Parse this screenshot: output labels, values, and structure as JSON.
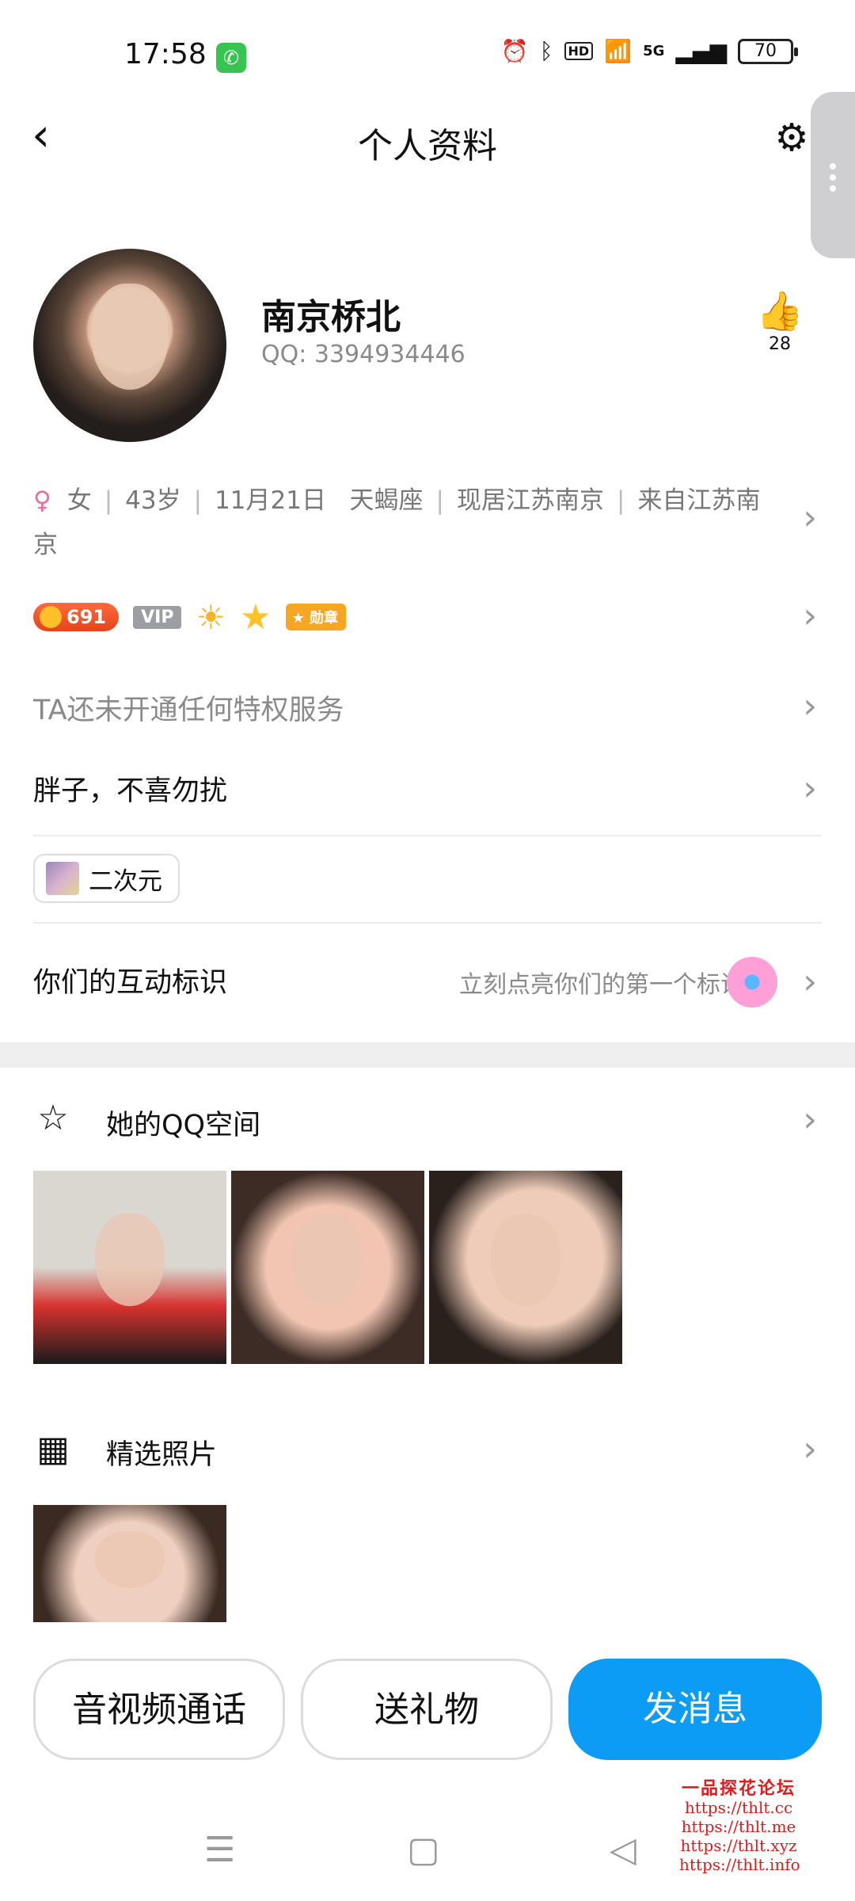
{
  "statusbar": {
    "time": "17:58",
    "network": "5G",
    "hd": "HD",
    "battery": "70"
  },
  "nav": {
    "title": "个人资料"
  },
  "profile": {
    "nickname": "南京桥北",
    "qq": "QQ: 3394934446",
    "likes": "28"
  },
  "info": {
    "gender_symbol": "♀",
    "gender": "女",
    "age": "43岁",
    "birthday": "11月21日",
    "zodiac": "天蝎座",
    "location": "现居江苏南京",
    "hometown_line1": "来自江苏南",
    "hometown_line2": "京"
  },
  "badges": {
    "level": "691",
    "vip": "VIP",
    "medal": "勋章"
  },
  "privilege_text": "TA还未开通任何特权服务",
  "signature": "胖子，不喜勿扰",
  "tag": {
    "label": "二次元"
  },
  "interaction": {
    "title": "你们的互动标识",
    "hint": "立刻点亮你们的第一个标识"
  },
  "qzone": {
    "title": "她的QQ空间"
  },
  "photos": {
    "title": "精选照片"
  },
  "actions": {
    "call": "音视频通话",
    "gift": "送礼物",
    "message": "发消息"
  },
  "watermark": {
    "title": "一品探花论坛",
    "urls": [
      "https://thlt.cc",
      "https://thlt.me",
      "https://thlt.xyz",
      "https://thlt.info"
    ]
  },
  "colors": {
    "primary": "#0d9cf5",
    "female": "#f0699a",
    "level_badge": "#e8431a"
  }
}
